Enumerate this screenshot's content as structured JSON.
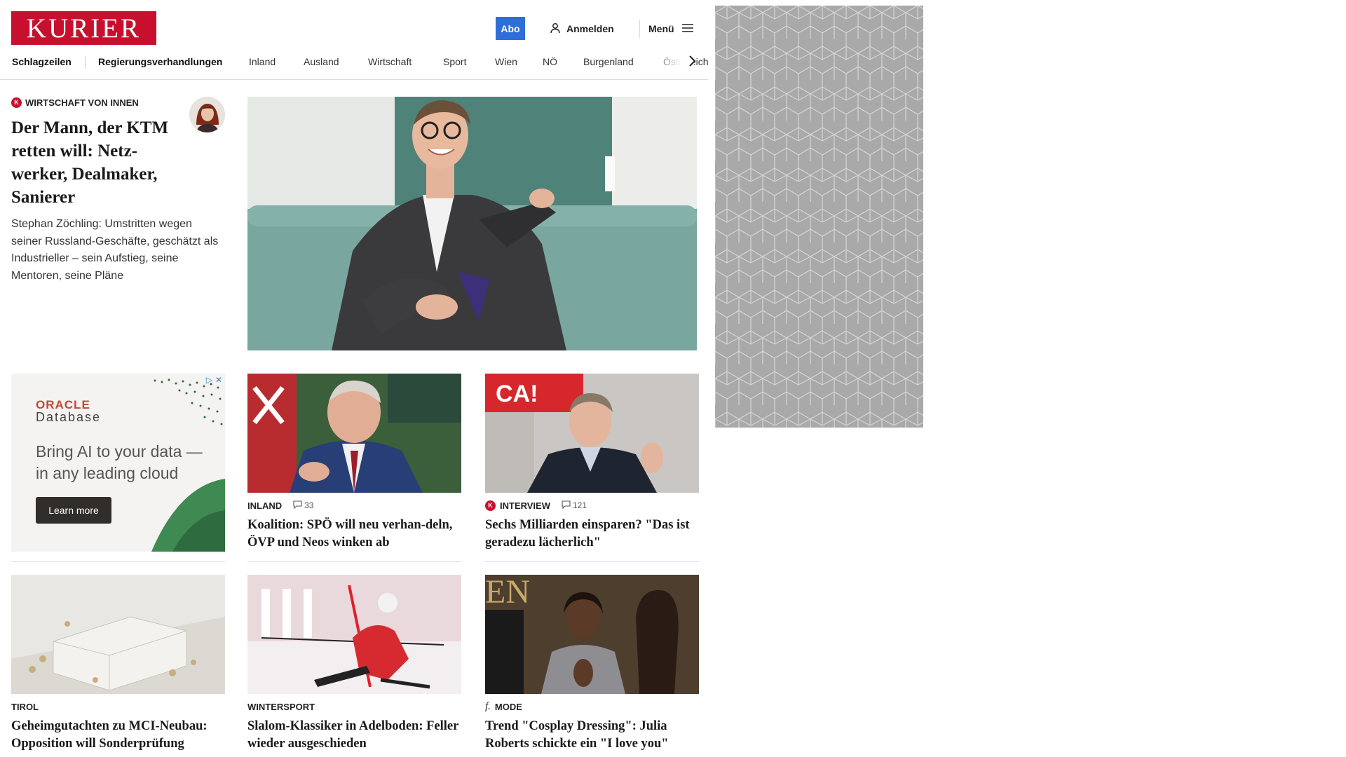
{
  "header": {
    "logo_text": "KURIER",
    "abo_label": "Abo",
    "login_label": "Anmelden",
    "menu_label": "Menü"
  },
  "nav": {
    "items": [
      {
        "label": "Schlagzeilen",
        "active": true
      },
      {
        "label": "Regierungsverhandlungen",
        "active": false
      },
      {
        "label": "Inland",
        "active": false
      },
      {
        "label": "Ausland",
        "active": false
      },
      {
        "label": "Wirtschaft",
        "active": false
      },
      {
        "label": "Sport",
        "active": false
      },
      {
        "label": "Wien",
        "active": false
      },
      {
        "label": "NÖ",
        "active": false
      },
      {
        "label": "Burgenland",
        "active": false
      },
      {
        "label": "Österreich",
        "active": false
      }
    ]
  },
  "hero": {
    "kicker": "WIRTSCHAFT VON INNEN",
    "title": "Der Mann, der KTM retten will: Netz-werker, Dealmaker, Sanierer",
    "lead": "Stephan Zöchling: Umstritten wegen seiner Russland-Geschäfte, geschätzt als Industrieller – sein Aufstieg, seine Mentoren, seine Pläne"
  },
  "ad": {
    "brand_line1": "ORACLE",
    "brand_line2": "Database",
    "headline": "Bring AI to your data —in any leading cloud",
    "cta": "Learn more"
  },
  "cards": [
    {
      "kicker": "INLAND",
      "comments": "33",
      "title": "Koalition: SPÖ will neu verhan-deln, ÖVP und Neos winken ab",
      "premium": false
    },
    {
      "kicker": "INTERVIEW",
      "comments": "121",
      "title": "Sechs Milliarden einsparen? \"Das ist geradezu lächerlich\"",
      "premium": true
    },
    {
      "kicker": "TIROL",
      "comments": "",
      "title": "Geheimgutachten zu MCI-Neubau: Opposition will Sonderprüfung",
      "premium": false
    },
    {
      "kicker": "WINTERSPORT",
      "comments": "",
      "title": "Slalom-Klassiker in Adelboden: Feller wieder ausgeschieden",
      "premium": false
    },
    {
      "kicker": "MODE",
      "comments": "",
      "title": "Trend \"Cosplay Dressing\": Julia Roberts schickte ein \"I love you\"",
      "premium": false
    }
  ],
  "colors": {
    "brand_red": "#c8102e",
    "abo_blue": "#2f6ed8",
    "sidebar_gray": "#a9a9a9"
  }
}
